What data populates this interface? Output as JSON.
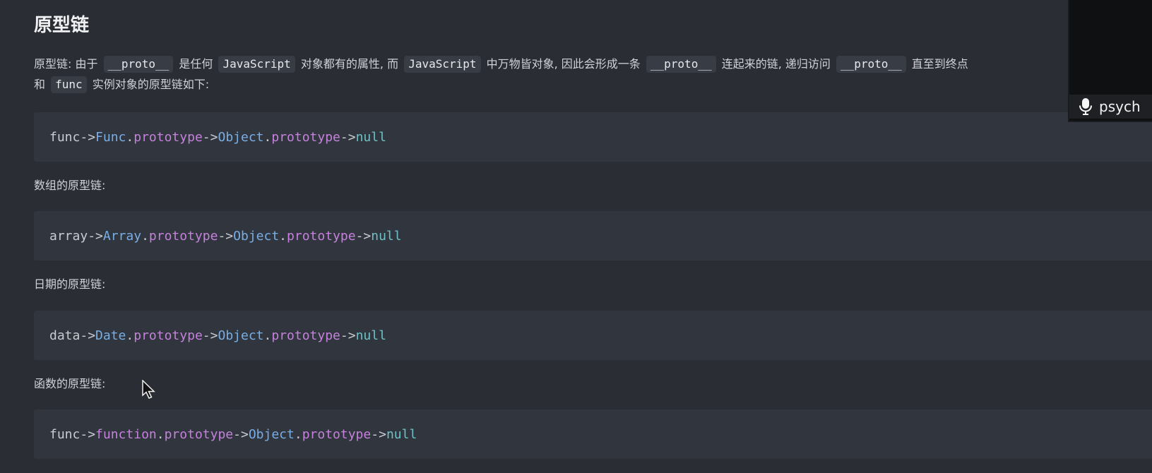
{
  "section": {
    "title": "原型链"
  },
  "paragraph": {
    "line1": {
      "prefix": "原型链: 由于",
      "code1": "__proto__",
      "text1": "是任何",
      "code2": "JavaScript",
      "text2": "对象都有的属性, 而",
      "code3": "JavaScript",
      "text3": "中万物皆对象, 因此会形成一条",
      "code4": "__proto__",
      "text4": "连起来的链, 递归访问",
      "code5": "__proto__",
      "text5": "直至到终点"
    },
    "line2": {
      "prefix": "和",
      "code1": "func",
      "text1": "实例对象的原型链如下:"
    }
  },
  "blocks": [
    {
      "tokens": [
        {
          "text": "func",
          "kind": "plain"
        },
        {
          "text": " -> ",
          "kind": "op"
        },
        {
          "text": "Func",
          "kind": "class"
        },
        {
          "text": ".",
          "kind": "plain"
        },
        {
          "text": "prototype",
          "kind": "prop"
        },
        {
          "text": " -> ",
          "kind": "op"
        },
        {
          "text": "Object",
          "kind": "class"
        },
        {
          "text": ".",
          "kind": "plain"
        },
        {
          "text": "prototype",
          "kind": "prop"
        },
        {
          "text": " -> ",
          "kind": "op"
        },
        {
          "text": "null",
          "kind": "null"
        }
      ]
    },
    {
      "tokens": [
        {
          "text": "array",
          "kind": "plain"
        },
        {
          "text": " -> ",
          "kind": "op"
        },
        {
          "text": "Array",
          "kind": "class"
        },
        {
          "text": ".",
          "kind": "plain"
        },
        {
          "text": "prototype",
          "kind": "prop"
        },
        {
          "text": " -> ",
          "kind": "op"
        },
        {
          "text": "Object",
          "kind": "class"
        },
        {
          "text": ".",
          "kind": "plain"
        },
        {
          "text": "prototype",
          "kind": "prop"
        },
        {
          "text": " -> ",
          "kind": "op"
        },
        {
          "text": "null",
          "kind": "null"
        }
      ]
    },
    {
      "tokens": [
        {
          "text": "data",
          "kind": "plain"
        },
        {
          "text": " -> ",
          "kind": "op"
        },
        {
          "text": "Date",
          "kind": "class"
        },
        {
          "text": ".",
          "kind": "plain"
        },
        {
          "text": "prototype",
          "kind": "prop"
        },
        {
          "text": " -> ",
          "kind": "op"
        },
        {
          "text": "Object",
          "kind": "class"
        },
        {
          "text": ".",
          "kind": "plain"
        },
        {
          "text": "prototype",
          "kind": "prop"
        },
        {
          "text": " -> ",
          "kind": "op"
        },
        {
          "text": "null",
          "kind": "null"
        }
      ]
    },
    {
      "tokens": [
        {
          "text": "func",
          "kind": "plain"
        },
        {
          "text": " -> ",
          "kind": "op"
        },
        {
          "text": "function",
          "kind": "prop"
        },
        {
          "text": ".",
          "kind": "plain"
        },
        {
          "text": "prototype",
          "kind": "prop"
        },
        {
          "text": " -> ",
          "kind": "op"
        },
        {
          "text": "Object",
          "kind": "class"
        },
        {
          "text": ".",
          "kind": "plain"
        },
        {
          "text": "prototype",
          "kind": "prop"
        },
        {
          "text": " -> ",
          "kind": "op"
        },
        {
          "text": "null",
          "kind": "null"
        }
      ]
    }
  ],
  "captions": {
    "array": "数组的原型链:",
    "date": "日期的原型链:",
    "function": "函数的原型链:"
  },
  "video": {
    "participant_name": "psych",
    "icon": "microphone-icon"
  },
  "cursor": {
    "icon": "mouse-pointer-icon"
  },
  "colors": {
    "background": "#2a2d34",
    "code_block": "#31353d",
    "inline_code": "#383c45",
    "class_token": "#79aee5",
    "prop_token": "#c482dc",
    "null_token": "#6ec1c6"
  }
}
